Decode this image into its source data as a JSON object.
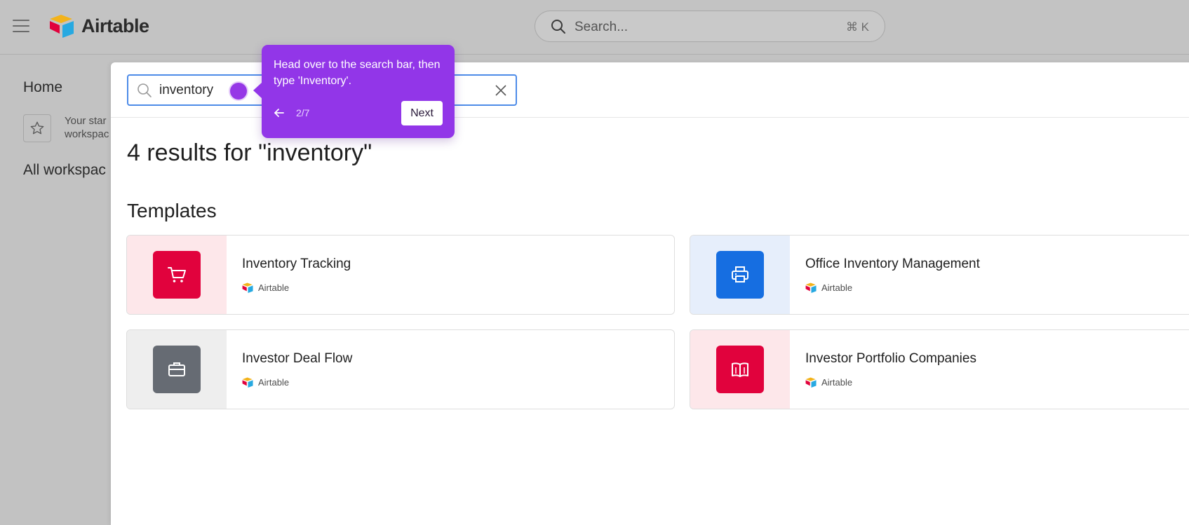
{
  "app": {
    "name": "Airtable",
    "search_placeholder": "Search...",
    "search_shortcut": "⌘ K"
  },
  "sidebar": {
    "home_label": "Home",
    "starred_text_line1": "Your star",
    "starred_text_line2": "workspac",
    "all_workspaces_label": "All workspac"
  },
  "modal": {
    "search_value": "inventory",
    "results_title": "4 results for \"inventory\"",
    "section_title": "Templates",
    "templates": [
      {
        "name": "Inventory Tracking",
        "publisher": "Airtable",
        "icon": "shopping-cart-icon",
        "tile_color": "#e1023d",
        "bg_color": "#fde7ea"
      },
      {
        "name": "Office Inventory Management",
        "publisher": "Airtable",
        "icon": "printer-icon",
        "tile_color": "#166ee1",
        "bg_color": "#e6eefb"
      },
      {
        "name": "Investor Deal Flow",
        "publisher": "Airtable",
        "icon": "briefcase-icon",
        "tile_color": "#666b73",
        "bg_color": "#eeeeee"
      },
      {
        "name": "Investor Portfolio Companies",
        "publisher": "Airtable",
        "icon": "open-book-icon",
        "tile_color": "#e1023d",
        "bg_color": "#fde7ea"
      }
    ]
  },
  "tour": {
    "message": "Head over to the search bar, then type 'Inventory'.",
    "step": "2/7",
    "next_label": "Next",
    "accent_color": "#9236e8"
  }
}
